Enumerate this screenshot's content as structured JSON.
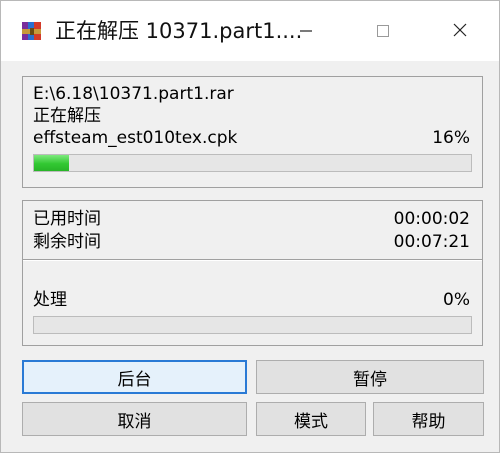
{
  "window": {
    "title": "正在解压 10371.part1....",
    "icon": "winrar-books-icon"
  },
  "titlebar_buttons": {
    "minimize_icon": "minimize-icon",
    "maximize_icon": "maximize-icon",
    "close_icon": "close-icon"
  },
  "archive": {
    "path": "E:\\6.18\\10371.part1.rar",
    "status": "正在解压",
    "current_file": "effsteam_est010tex.cpk",
    "file_percent_text": "16%",
    "file_progress": 0.08
  },
  "timing": {
    "elapsed_label": "已用时间",
    "elapsed_value": "00:00:02",
    "remaining_label": "剩余时间",
    "remaining_value": "00:07:21"
  },
  "processing": {
    "label": "处理",
    "percent_text": "0%",
    "progress": 0
  },
  "buttons": {
    "background": "后台",
    "pause": "暂停",
    "cancel": "取消",
    "mode": "模式",
    "help": "帮助"
  },
  "colors": {
    "progress_green": "#32c832",
    "focus_border": "#2a7ad5"
  }
}
